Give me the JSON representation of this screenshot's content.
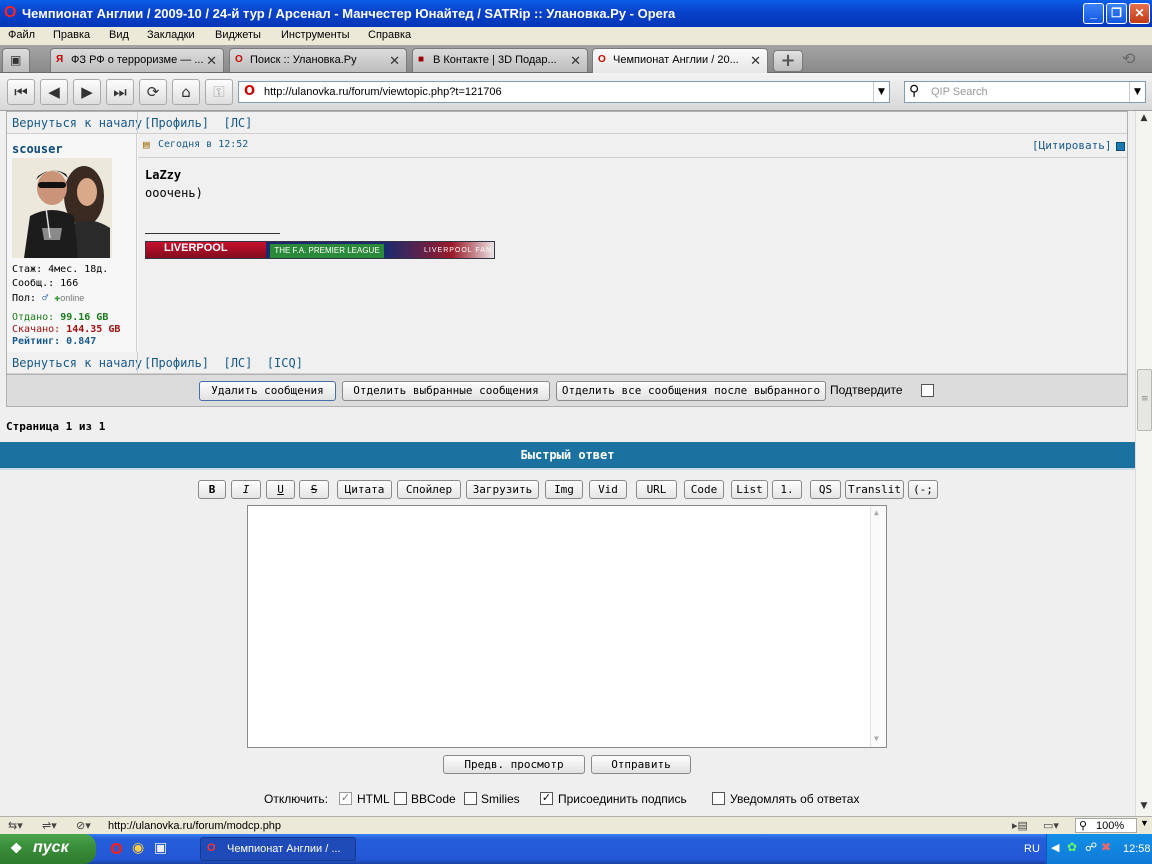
{
  "window": {
    "title": "Чемпионат Англии / 2009-10 / 24-й тур / Арсенал - Манчестер Юнайтед / SATRip :: Улановка.Ру - Opera"
  },
  "menu": [
    "Файл",
    "Правка",
    "Вид",
    "Закладки",
    "Виджеты",
    "Инструменты",
    "Справка"
  ],
  "tabs": [
    {
      "label": "ФЗ РФ о терроризме — ...",
      "icon": "yandex-icon"
    },
    {
      "label": "Поиск :: Улановка.Ру",
      "icon": "opera-icon"
    },
    {
      "label": "В Контакте | 3D Подар...",
      "icon": "vk-icon"
    },
    {
      "label": "Чемпионат Англии / 20...",
      "icon": "opera-icon",
      "active": true
    }
  ],
  "address": {
    "url": "http://ulanovka.ru/forum/viewtopic.php?t=121706"
  },
  "search": {
    "placeholder": "QIP Search"
  },
  "forum": {
    "back_to_top": "Вернуться к началу",
    "top_links": "[Профиль]  [ЛС]",
    "bottom_links": "[Профиль]  [ЛС]  [ICQ]",
    "author": "scouser",
    "post_time": "Сегодня в 12:52",
    "quote": "[Цитировать]",
    "stats": {
      "experience": "Стаж: 4мес. 18д.",
      "messages": "Сообщ.: 166",
      "gender_label": "Пол:",
      "online": "online",
      "uploaded_label": "Отдано:",
      "uploaded": "99.16 GB",
      "downloaded_label": "Скачано:",
      "downloaded": "144.35 GB",
      "rating": "Рейтинг: 0.847"
    },
    "post": {
      "quoted_user": "LaZzy",
      "text": "ооочень)"
    },
    "signature": {
      "left": "LIVERPOOL",
      "middle": "THE F.A. PREMIER LEAGUE",
      "right": "LIVERPOOL FAN"
    },
    "mod": {
      "delete": "Удалить сообщения",
      "split_selected": "Отделить выбранные сообщения",
      "split_after": "Отделить все сообщения после выбранного",
      "confirm": "Подтвердите"
    },
    "pagination": "Страница 1 из 1"
  },
  "quick_reply": {
    "title": "Быстрый ответ",
    "format_buttons": [
      "B",
      "I",
      "U",
      "S",
      "Цитата",
      "Спойлер",
      "Загрузить",
      "Img",
      "Vid",
      "URL",
      "Code",
      "List",
      "1.",
      "QS",
      "Translit",
      "(-;"
    ],
    "preview": "Предв. просмотр",
    "submit": "Отправить",
    "disable_label": "Отключить:",
    "options": [
      {
        "label": "HTML",
        "checked": true
      },
      {
        "label": "BBCode",
        "checked": false
      },
      {
        "label": "Smilies",
        "checked": false
      },
      {
        "label": "Присоединить подпись",
        "checked": true
      },
      {
        "label": "Уведомлять об ответах",
        "checked": false
      }
    ]
  },
  "statusbar": {
    "url": "http://ulanovka.ru/forum/modcp.php",
    "zoom": "100%"
  },
  "taskbar": {
    "start": "пуск",
    "task": "Чемпионат Англии / ...",
    "lang": "RU",
    "clock": "12:58"
  }
}
